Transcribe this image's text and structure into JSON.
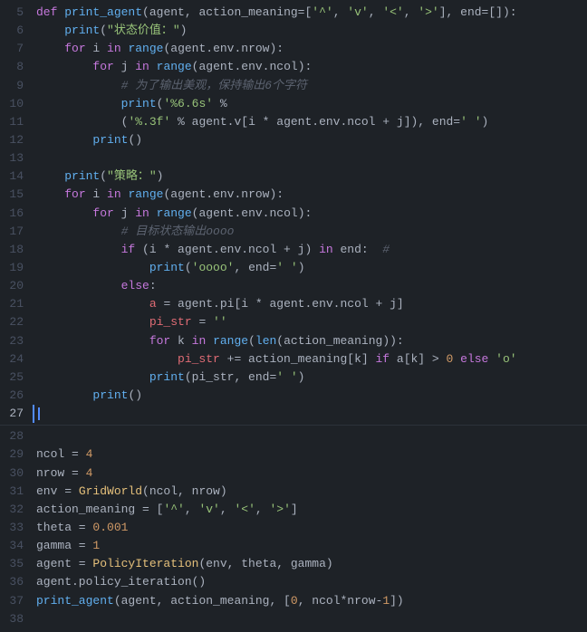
{
  "editor": {
    "bg": "#1e2227",
    "lines": [
      {
        "num": 5,
        "tokens": [
          {
            "t": "def ",
            "c": "kw"
          },
          {
            "t": "print_agent",
            "c": "blue"
          },
          {
            "t": "(agent, action_meaning=[",
            "c": "white"
          },
          {
            "t": "'^'",
            "c": "green"
          },
          {
            "t": ", ",
            "c": "white"
          },
          {
            "t": "'v'",
            "c": "green"
          },
          {
            "t": ", ",
            "c": "white"
          },
          {
            "t": "'<'",
            "c": "green"
          },
          {
            "t": ", ",
            "c": "white"
          },
          {
            "t": "'>'",
            "c": "green"
          },
          {
            "t": "], end=[]):",
            "c": "white"
          }
        ]
      },
      {
        "num": 6,
        "tokens": [
          {
            "t": "    ",
            "c": "white"
          },
          {
            "t": "print",
            "c": "blue"
          },
          {
            "t": "(",
            "c": "white"
          },
          {
            "t": "\"状态价值：\"",
            "c": "green"
          },
          {
            "t": ")",
            "c": "white"
          }
        ]
      },
      {
        "num": 7,
        "tokens": [
          {
            "t": "    ",
            "c": "white"
          },
          {
            "t": "for",
            "c": "purple"
          },
          {
            "t": " i ",
            "c": "white"
          },
          {
            "t": "in",
            "c": "purple"
          },
          {
            "t": " ",
            "c": "white"
          },
          {
            "t": "range",
            "c": "blue"
          },
          {
            "t": "(agent.env.nrow):",
            "c": "white"
          }
        ]
      },
      {
        "num": 8,
        "tokens": [
          {
            "t": "        ",
            "c": "white"
          },
          {
            "t": "for",
            "c": "purple"
          },
          {
            "t": " j ",
            "c": "white"
          },
          {
            "t": "in",
            "c": "purple"
          },
          {
            "t": " ",
            "c": "white"
          },
          {
            "t": "range",
            "c": "blue"
          },
          {
            "t": "(agent.env.ncol):",
            "c": "white"
          }
        ]
      },
      {
        "num": 9,
        "tokens": [
          {
            "t": "            ",
            "c": "white"
          },
          {
            "t": "# 为了输出美观，保持输出6个字符",
            "c": "cmt"
          }
        ]
      },
      {
        "num": 10,
        "tokens": [
          {
            "t": "            ",
            "c": "white"
          },
          {
            "t": "print",
            "c": "blue"
          },
          {
            "t": "(",
            "c": "white"
          },
          {
            "t": "'%6.6s'",
            "c": "green"
          },
          {
            "t": " %",
            "c": "white"
          }
        ]
      },
      {
        "num": 11,
        "tokens": [
          {
            "t": "            ",
            "c": "white"
          },
          {
            "t": "(",
            "c": "white"
          },
          {
            "t": "'%.3f'",
            "c": "green"
          },
          {
            "t": " % agent.v[i * agent.env.ncol + j]), end=",
            "c": "white"
          },
          {
            "t": "' '",
            "c": "green"
          },
          {
            "t": ")",
            "c": "white"
          }
        ]
      },
      {
        "num": 12,
        "tokens": [
          {
            "t": "        ",
            "c": "white"
          },
          {
            "t": "print",
            "c": "blue"
          },
          {
            "t": "()",
            "c": "white"
          }
        ]
      },
      {
        "num": 13,
        "tokens": []
      },
      {
        "num": 14,
        "tokens": [
          {
            "t": "    ",
            "c": "white"
          },
          {
            "t": "print",
            "c": "blue"
          },
          {
            "t": "(",
            "c": "white"
          },
          {
            "t": "\"策略：\"",
            "c": "green"
          },
          {
            "t": ")",
            "c": "white"
          }
        ]
      },
      {
        "num": 15,
        "tokens": [
          {
            "t": "    ",
            "c": "white"
          },
          {
            "t": "for",
            "c": "purple"
          },
          {
            "t": " i ",
            "c": "white"
          },
          {
            "t": "in",
            "c": "purple"
          },
          {
            "t": " ",
            "c": "white"
          },
          {
            "t": "range",
            "c": "blue"
          },
          {
            "t": "(agent.env.nrow):",
            "c": "white"
          }
        ]
      },
      {
        "num": 16,
        "tokens": [
          {
            "t": "        ",
            "c": "white"
          },
          {
            "t": "for",
            "c": "purple"
          },
          {
            "t": " j ",
            "c": "white"
          },
          {
            "t": "in",
            "c": "purple"
          },
          {
            "t": " ",
            "c": "white"
          },
          {
            "t": "range",
            "c": "blue"
          },
          {
            "t": "(agent.env.ncol):",
            "c": "white"
          }
        ]
      },
      {
        "num": 17,
        "tokens": [
          {
            "t": "            ",
            "c": "white"
          },
          {
            "t": "# 目标状态输出oooo",
            "c": "cmt"
          }
        ]
      },
      {
        "num": 18,
        "tokens": [
          {
            "t": "            ",
            "c": "white"
          },
          {
            "t": "if",
            "c": "purple"
          },
          {
            "t": " (i * agent.env.ncol + j) ",
            "c": "white"
          },
          {
            "t": "in",
            "c": "purple"
          },
          {
            "t": " end:  ",
            "c": "white"
          },
          {
            "t": "#",
            "c": "cmt"
          }
        ]
      },
      {
        "num": 19,
        "tokens": [
          {
            "t": "                ",
            "c": "white"
          },
          {
            "t": "print",
            "c": "blue"
          },
          {
            "t": "(",
            "c": "white"
          },
          {
            "t": "'oooo'",
            "c": "green"
          },
          {
            "t": ", end=",
            "c": "white"
          },
          {
            "t": "' '",
            "c": "green"
          },
          {
            "t": ")",
            "c": "white"
          }
        ]
      },
      {
        "num": 20,
        "tokens": [
          {
            "t": "            ",
            "c": "white"
          },
          {
            "t": "else",
            "c": "purple"
          },
          {
            "t": ":",
            "c": "white"
          }
        ]
      },
      {
        "num": 21,
        "tokens": [
          {
            "t": "                ",
            "c": "white"
          },
          {
            "t": "a",
            "c": "red"
          },
          {
            "t": " = agent.pi[i * agent.env.ncol + j]",
            "c": "white"
          }
        ]
      },
      {
        "num": 22,
        "tokens": [
          {
            "t": "                ",
            "c": "white"
          },
          {
            "t": "pi_str",
            "c": "red"
          },
          {
            "t": " = ",
            "c": "white"
          },
          {
            "t": "''",
            "c": "green"
          }
        ]
      },
      {
        "num": 23,
        "tokens": [
          {
            "t": "                ",
            "c": "white"
          },
          {
            "t": "for",
            "c": "purple"
          },
          {
            "t": " k ",
            "c": "white"
          },
          {
            "t": "in",
            "c": "purple"
          },
          {
            "t": " ",
            "c": "white"
          },
          {
            "t": "range",
            "c": "blue"
          },
          {
            "t": "(",
            "c": "white"
          },
          {
            "t": "len",
            "c": "blue"
          },
          {
            "t": "(action_meaning)):",
            "c": "white"
          }
        ]
      },
      {
        "num": 24,
        "tokens": [
          {
            "t": "                    ",
            "c": "white"
          },
          {
            "t": "pi_str",
            "c": "red"
          },
          {
            "t": " += action_meaning[k] ",
            "c": "white"
          },
          {
            "t": "if",
            "c": "purple"
          },
          {
            "t": " a[k] > ",
            "c": "white"
          },
          {
            "t": "0",
            "c": "orange"
          },
          {
            "t": " ",
            "c": "white"
          },
          {
            "t": "else",
            "c": "purple"
          },
          {
            "t": " ",
            "c": "white"
          },
          {
            "t": "'o'",
            "c": "green"
          }
        ]
      },
      {
        "num": 25,
        "tokens": [
          {
            "t": "                ",
            "c": "white"
          },
          {
            "t": "print",
            "c": "blue"
          },
          {
            "t": "(pi_str, end=",
            "c": "white"
          },
          {
            "t": "' '",
            "c": "green"
          },
          {
            "t": ")",
            "c": "white"
          }
        ]
      },
      {
        "num": 26,
        "tokens": [
          {
            "t": "        ",
            "c": "white"
          },
          {
            "t": "print",
            "c": "blue"
          },
          {
            "t": "()",
            "c": "white"
          }
        ]
      },
      {
        "num": 27,
        "tokens": [
          {
            "t": "",
            "c": "white"
          }
        ],
        "active": true
      },
      {
        "num": 28,
        "tokens": []
      },
      {
        "num": 29,
        "tokens": [
          {
            "t": "ncol = ",
            "c": "white"
          },
          {
            "t": "4",
            "c": "orange"
          }
        ]
      },
      {
        "num": 30,
        "tokens": [
          {
            "t": "nrow = ",
            "c": "white"
          },
          {
            "t": "4",
            "c": "orange"
          }
        ]
      },
      {
        "num": 31,
        "tokens": [
          {
            "t": "env = ",
            "c": "white"
          },
          {
            "t": "GridWorld",
            "c": "yellow"
          },
          {
            "t": "(ncol, nrow)",
            "c": "white"
          }
        ]
      },
      {
        "num": 32,
        "tokens": [
          {
            "t": "action_meaning = [",
            "c": "white"
          },
          {
            "t": "'^'",
            "c": "green"
          },
          {
            "t": ", ",
            "c": "white"
          },
          {
            "t": "'v'",
            "c": "green"
          },
          {
            "t": ", ",
            "c": "white"
          },
          {
            "t": "'<'",
            "c": "green"
          },
          {
            "t": ", ",
            "c": "white"
          },
          {
            "t": "'>'",
            "c": "green"
          },
          {
            "t": "]",
            "c": "white"
          }
        ]
      },
      {
        "num": 33,
        "tokens": [
          {
            "t": "theta = ",
            "c": "white"
          },
          {
            "t": "0.001",
            "c": "orange"
          }
        ]
      },
      {
        "num": 34,
        "tokens": [
          {
            "t": "gamma = ",
            "c": "white"
          },
          {
            "t": "1",
            "c": "orange"
          }
        ]
      },
      {
        "num": 35,
        "tokens": [
          {
            "t": "agent = ",
            "c": "white"
          },
          {
            "t": "PolicyIteration",
            "c": "yellow"
          },
          {
            "t": "(env, theta, gamma)",
            "c": "white"
          }
        ]
      },
      {
        "num": 36,
        "tokens": [
          {
            "t": "agent.policy_iteration()",
            "c": "white"
          }
        ]
      },
      {
        "num": 37,
        "tokens": [
          {
            "t": "print_agent",
            "c": "blue"
          },
          {
            "t": "(agent, action_meaning, [",
            "c": "white"
          },
          {
            "t": "0",
            "c": "orange"
          },
          {
            "t": ", ncol*nrow-",
            "c": "white"
          },
          {
            "t": "1",
            "c": "orange"
          },
          {
            "t": "])",
            "c": "white"
          }
        ]
      },
      {
        "num": 38,
        "tokens": []
      }
    ]
  }
}
